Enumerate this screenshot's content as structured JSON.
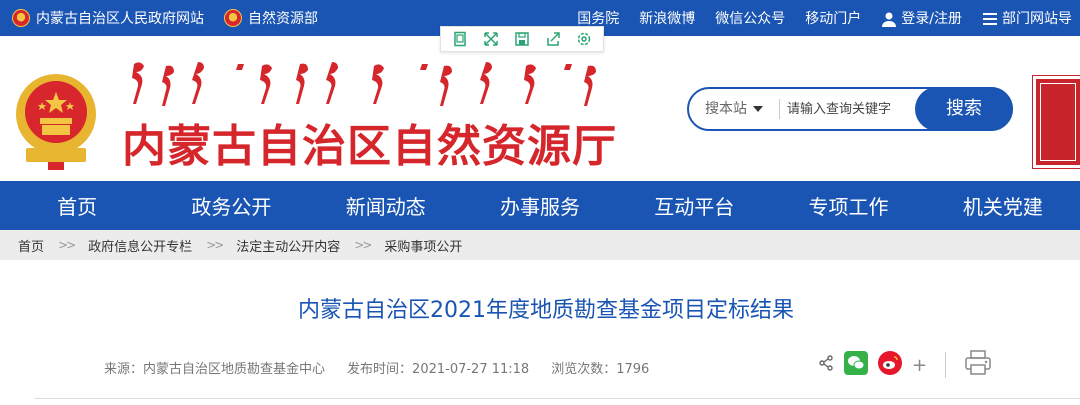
{
  "topbar": {
    "site1": "内蒙古自治区人民政府网站",
    "site2": "自然资源部",
    "links": [
      "国务院",
      "新浪微博",
      "微信公众号",
      "移动门户"
    ],
    "login": "登录/注册",
    "dept": "部门网站导"
  },
  "floattools": [
    "page-icon",
    "expand-icon",
    "save-icon",
    "share-out-icon",
    "settings-icon"
  ],
  "header": {
    "title": "内蒙古自治区自然资源厅",
    "search": {
      "scope": "搜本站",
      "placeholder": "请输入查询关键字",
      "button": "搜索"
    }
  },
  "nav": [
    "首页",
    "政务公开",
    "新闻动态",
    "办事服务",
    "互动平台",
    "专项工作",
    "机关党建"
  ],
  "breadcrumb": [
    "首页",
    "政府信息公开专栏",
    "法定主动公开内容",
    "采购事项公开"
  ],
  "breadcrumb_sep": ">>",
  "article": {
    "title": "内蒙古自治区2021年度地质勘查基金项目定标结果",
    "source_label": "来源：",
    "source": "内蒙古自治区地质勘查基金中心",
    "time_label": "发布时间：",
    "time": "2021-07-27 11:18",
    "views_label": "浏览次数：",
    "views": "1796",
    "share_more": "+"
  },
  "colors": {
    "primary": "#1a55b3",
    "red": "#d5262c",
    "wechat": "#36b149",
    "weibo": "#e6162d"
  }
}
